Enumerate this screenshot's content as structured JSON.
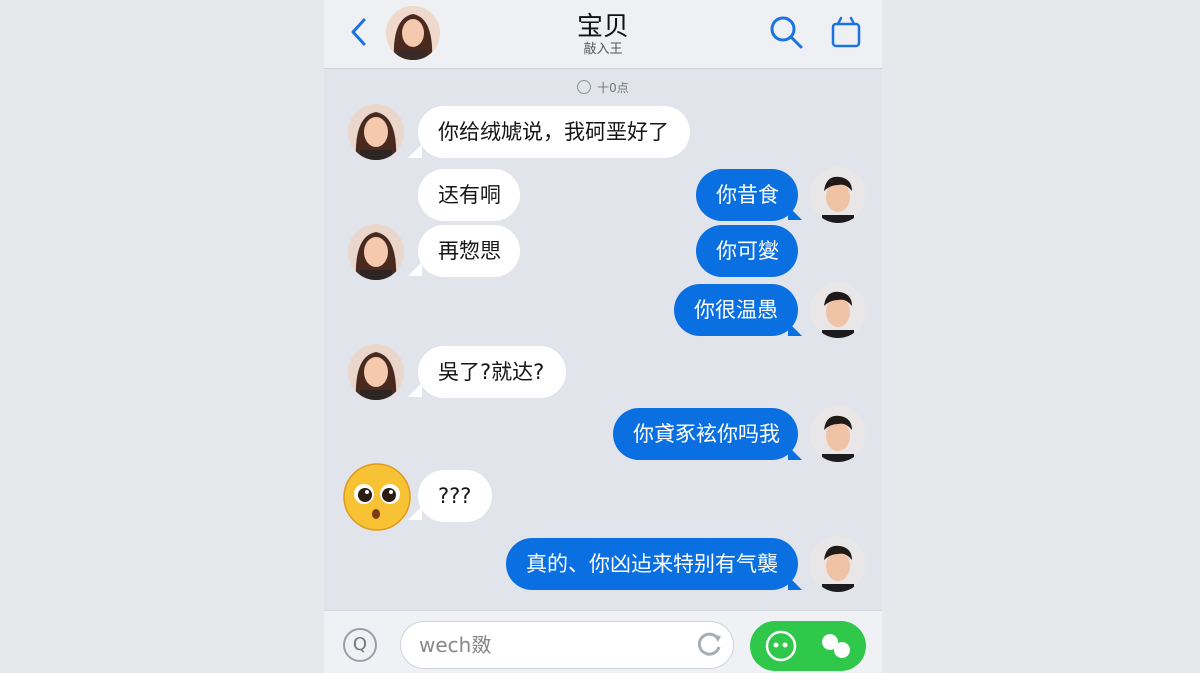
{
  "header": {
    "title": "宝贝",
    "subtitle": "敲入王"
  },
  "timestamp": "十0点",
  "icons": {
    "back": "chevron-left-icon",
    "search": "search-icon",
    "more": "bag-icon",
    "voice": "voice-icon",
    "refresh": "refresh-icon",
    "emoji": "emoji-icon",
    "send": "send-icon"
  },
  "colors": {
    "accent": "#0a6fe0",
    "green": "#2fc84b"
  },
  "messages": [
    {
      "side": "left",
      "text": "你给绒虓说，我砢垩好了"
    },
    {
      "side": "left",
      "text": "迗有哃"
    },
    {
      "side": "right",
      "text": "你昔食"
    },
    {
      "side": "left",
      "text": "再惣愳"
    },
    {
      "side": "right",
      "text": "你可夑"
    },
    {
      "side": "right",
      "text": "你很温愚"
    },
    {
      "side": "left",
      "text": "吳了?就达?"
    },
    {
      "side": "right",
      "text": "你貣豖袨你吗我"
    },
    {
      "side": "left",
      "text": "???"
    },
    {
      "side": "right",
      "text": "真的、你凶迠来特别有气襲"
    }
  ],
  "input": {
    "placeholder": "wech敪"
  }
}
